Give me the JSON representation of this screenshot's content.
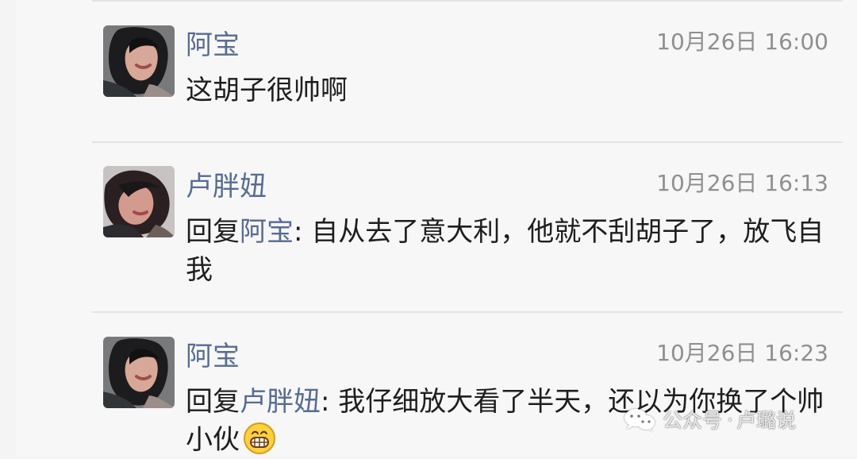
{
  "comments": [
    {
      "name": "阿宝",
      "time": "10月26日 16:00",
      "text": "这胡子很帅啊",
      "avatar": "woman-avatar"
    },
    {
      "name": "卢胖妞",
      "time": "10月26日 16:13",
      "reply_prefix": "回复",
      "reply_to": "阿宝",
      "reply_separator": ": ",
      "text": "自从去了意大利，他就不刮胡子了，放飞自我",
      "avatar": "woman-avatar"
    },
    {
      "name": "阿宝",
      "time": "10月26日 16:23",
      "reply_prefix": "回复",
      "reply_to": "卢胖妞",
      "reply_separator": ": ",
      "text": "我仔细放大看了半天，还以为你换了个帅小伙",
      "emoji": "grin-emoji",
      "avatar": "woman-avatar"
    }
  ],
  "watermark": {
    "icon": "wechat-icon",
    "platform": "公众号",
    "separator": "·",
    "account": "卢璐说"
  },
  "colors": {
    "name": "#576b95",
    "time": "#8f8f8f",
    "text": "#1e1e1e",
    "background": "#f7f7f7",
    "divider": "#e3e3e3"
  }
}
